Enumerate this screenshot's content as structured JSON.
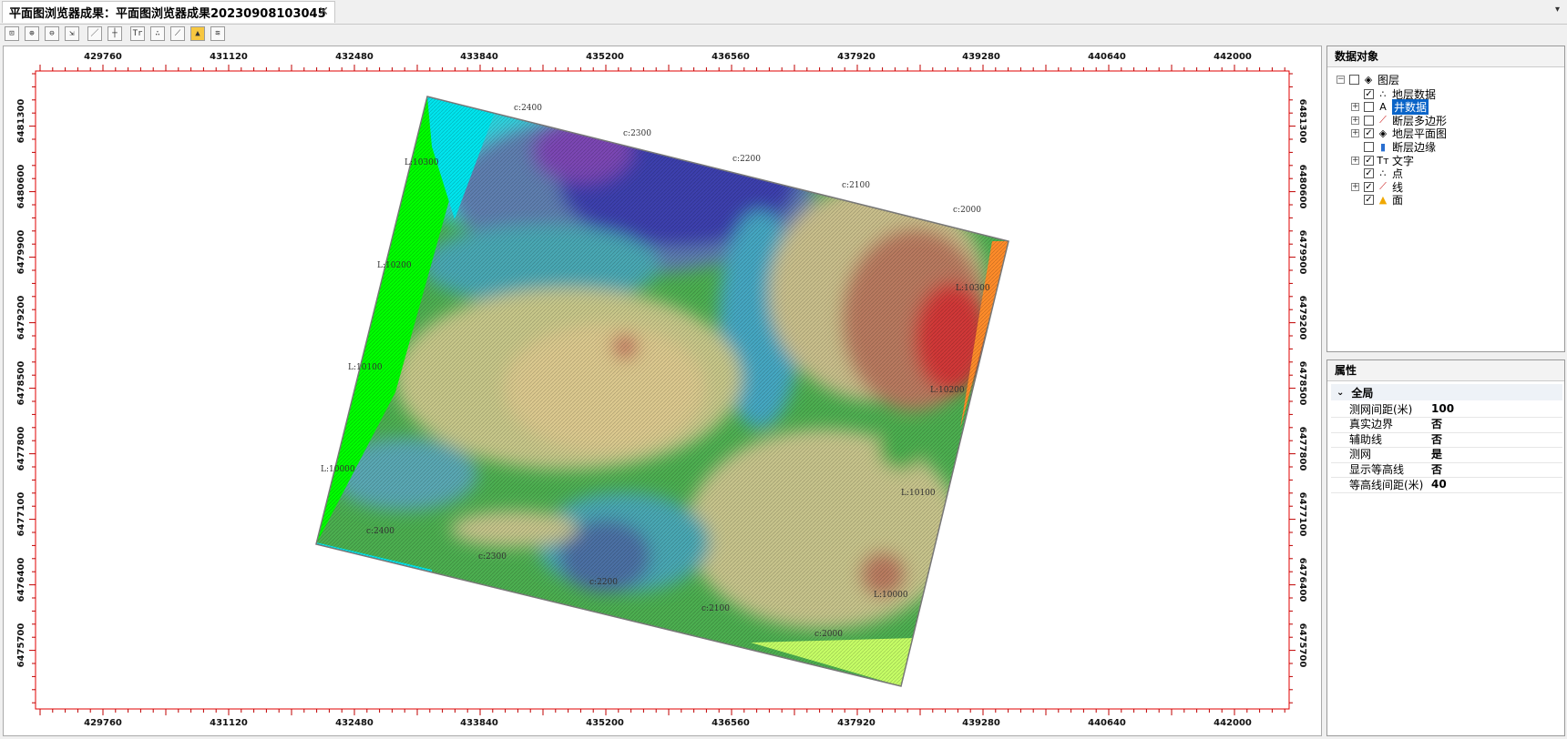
{
  "tab": {
    "title": "平面图浏览器成果：平面图浏览器成果20230908103045",
    "close": "✕"
  },
  "tabmenu": "▾",
  "toolbar": [
    "⊡",
    "⊕",
    "⊖",
    "⇲",
    "／",
    "┼",
    "Tr",
    "∴",
    "⟋",
    "▲",
    "≋"
  ],
  "map": {
    "x_ticks": [
      "429760",
      "431120",
      "432480",
      "433840",
      "435200",
      "436560",
      "437920",
      "439280",
      "440640",
      "442000"
    ],
    "y_ticks": [
      "6481300",
      "6480600",
      "6479900",
      "6479200",
      "6478500",
      "6477800",
      "6477100",
      "6476400",
      "6475700"
    ],
    "contour_labels_top": [
      "c:2400",
      "c:2300",
      "c:2200",
      "c:2100",
      "c:2000"
    ],
    "contour_labels_bottom": [
      "c:2400",
      "c:2300",
      "c:2200",
      "c:2100",
      "c:2000"
    ],
    "contour_labels_left": [
      "L:10300",
      "L:10200",
      "L:10100",
      "L:10000"
    ],
    "contour_labels_right": [
      "L:10300",
      "L:10200",
      "L:10100",
      "L:10000"
    ]
  },
  "layers_panel": {
    "title": "数据对象",
    "root": "图层",
    "items": [
      {
        "label": "地层数据",
        "checked": true,
        "expander": false,
        "icon": "∴"
      },
      {
        "label": "井数据",
        "checked": false,
        "expander": true,
        "icon": "A",
        "selected": true
      },
      {
        "label": "断层多边形",
        "checked": false,
        "expander": true,
        "icon": "⟋"
      },
      {
        "label": "地层平面图",
        "checked": true,
        "expander": true,
        "icon": "◈"
      },
      {
        "label": "断层边缘",
        "checked": false,
        "expander": false,
        "icon": "▮"
      },
      {
        "label": "文字",
        "checked": true,
        "expander": true,
        "icon": "Tт"
      },
      {
        "label": "点",
        "checked": true,
        "expander": false,
        "icon": "∴"
      },
      {
        "label": "线",
        "checked": true,
        "expander": true,
        "icon": "⟋"
      },
      {
        "label": "面",
        "checked": true,
        "expander": false,
        "icon": "▲"
      }
    ]
  },
  "props_panel": {
    "title": "属性",
    "group": "全局",
    "rows": [
      {
        "k": "测网间距(米)",
        "v": "100"
      },
      {
        "k": "真实边界",
        "v": "否"
      },
      {
        "k": "辅助线",
        "v": "否"
      },
      {
        "k": "测网",
        "v": "是"
      },
      {
        "k": "显示等高线",
        "v": "否"
      },
      {
        "k": "等高线间距(米)",
        "v": "40"
      }
    ]
  },
  "colors": {
    "frame": "#e00000",
    "selection": "#0a64c8"
  }
}
